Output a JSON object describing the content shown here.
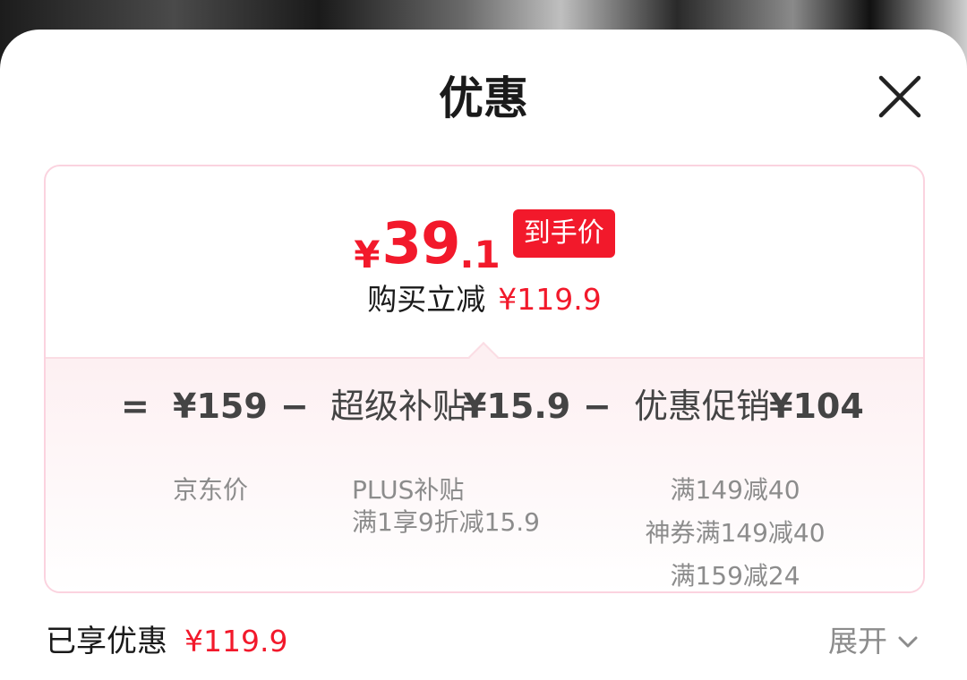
{
  "sheet": {
    "title": "优惠"
  },
  "card": {
    "price": {
      "symbol": "¥",
      "integer": "39",
      "decimal": ".1",
      "tag": "到手价"
    },
    "savings": {
      "label": "购买立减",
      "amount": "¥119.9"
    },
    "formula": {
      "equals": "=",
      "minus1": "−",
      "minus2": "−",
      "base": {
        "value": "¥159",
        "label": "京东价"
      },
      "subsidy": {
        "label": "超级补贴",
        "value": "¥15.9",
        "details": [
          "PLUS补贴",
          "满1享9折减15.9"
        ]
      },
      "promo": {
        "label": "优惠促销",
        "value": "¥104",
        "details": [
          "满149减40",
          "神券满149减40",
          "满159减24"
        ]
      }
    }
  },
  "footer": {
    "label": "已享优惠",
    "amount": "¥119.9",
    "expand_label": "展开",
    "expand_icon": "chevron-down-icon"
  },
  "icons": {
    "close": "close-icon"
  },
  "colors": {
    "accent": "#f2192b",
    "card_border": "#fbd3df",
    "muted": "#8c8c8c"
  }
}
